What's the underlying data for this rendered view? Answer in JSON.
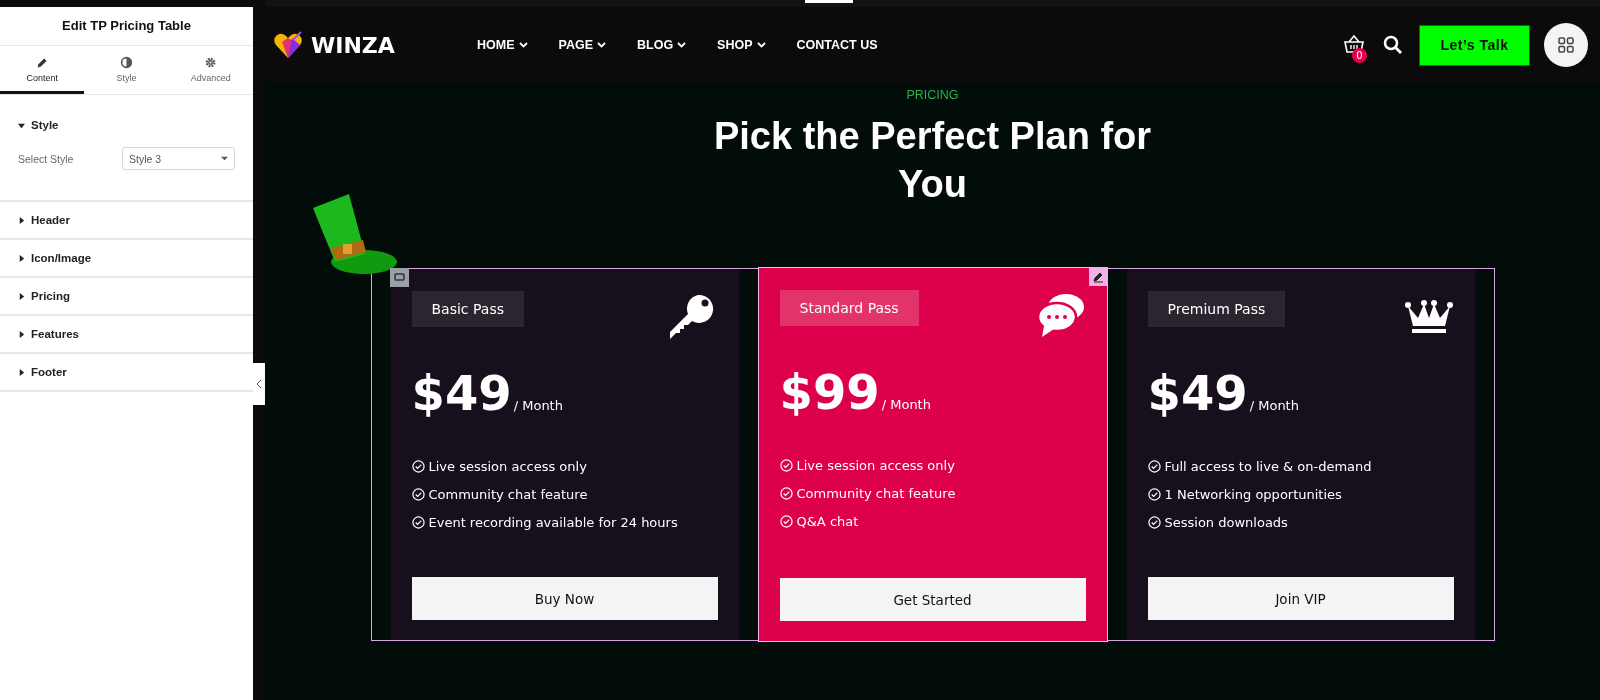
{
  "panel": {
    "title": "Edit TP Pricing Table",
    "tabs": [
      {
        "label": "Content",
        "selected": true
      },
      {
        "label": "Style",
        "selected": false
      },
      {
        "label": "Advanced",
        "selected": false
      }
    ],
    "sections": [
      {
        "label": "Style",
        "expanded": true,
        "control": {
          "label": "Select Style",
          "value": "Style 3"
        }
      },
      {
        "label": "Header",
        "expanded": false
      },
      {
        "label": "Icon/Image",
        "expanded": false
      },
      {
        "label": "Pricing",
        "expanded": false
      },
      {
        "label": "Features",
        "expanded": false
      },
      {
        "label": "Footer",
        "expanded": false
      }
    ]
  },
  "site": {
    "logo": "WINZA",
    "nav": [
      {
        "label": "HOME",
        "dropdown": true
      },
      {
        "label": "PAGE",
        "dropdown": true
      },
      {
        "label": "BLOG",
        "dropdown": true
      },
      {
        "label": "SHOP",
        "dropdown": true
      },
      {
        "label": "CONTACT US",
        "dropdown": false
      }
    ],
    "cart_count": "0",
    "cta": "Let’s Talk",
    "eyebrow": "PRICING",
    "heading": "Pick the Perfect Plan for You",
    "plans": [
      {
        "name": "Basic Pass",
        "price": "$49",
        "period": "/ Month",
        "featured": false,
        "features": [
          "Live session access only",
          "Community chat feature",
          "Event recording available for 24 hours"
        ],
        "button": "Buy Now"
      },
      {
        "name": "Standard Pass",
        "price": "$99",
        "period": "/ Month",
        "featured": true,
        "features": [
          "Live session access only",
          "Community chat feature",
          "Q&A chat"
        ],
        "button": "Get Started"
      },
      {
        "name": "Premium Pass",
        "price": "$49",
        "period": "/ Month",
        "featured": false,
        "features": [
          "Full access to live & on-demand",
          "1 Networking opportunities",
          "Session downloads"
        ],
        "button": "Join VIP"
      }
    ]
  }
}
